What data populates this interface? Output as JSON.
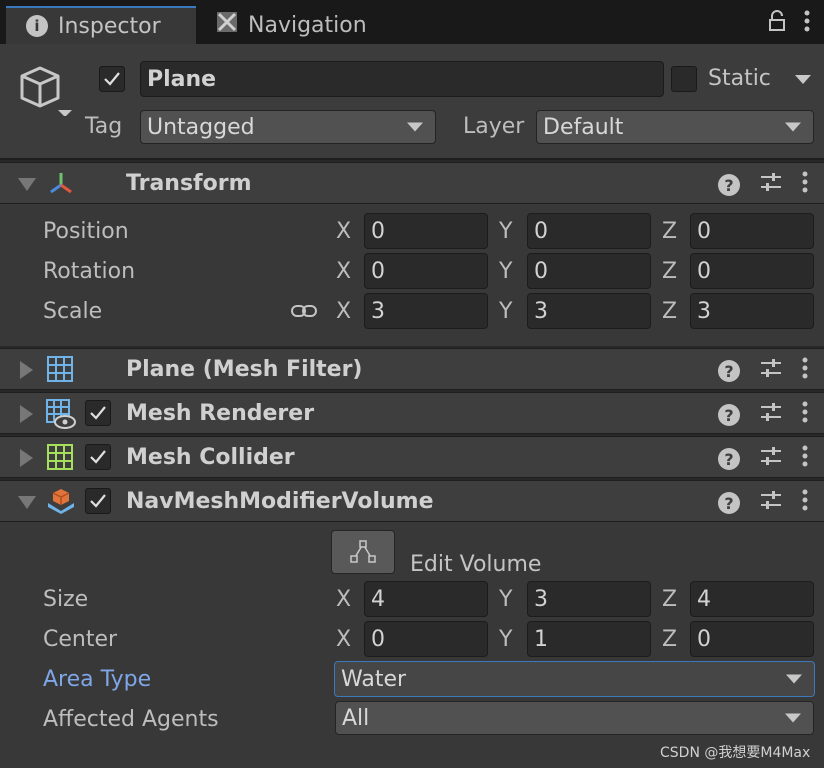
{
  "tabs": {
    "inspector": "Inspector",
    "navigation": "Navigation"
  },
  "header": {
    "object_name": "Plane",
    "static_label": "Static",
    "tag_label": "Tag",
    "tag_value": "Untagged",
    "layer_label": "Layer",
    "layer_value": "Default"
  },
  "transform": {
    "title": "Transform",
    "position_label": "Position",
    "rotation_label": "Rotation",
    "scale_label": "Scale",
    "x": "X",
    "y": "Y",
    "z": "Z",
    "position": [
      "0",
      "0",
      "0"
    ],
    "rotation": [
      "0",
      "0",
      "0"
    ],
    "scale": [
      "3",
      "3",
      "3"
    ]
  },
  "components": {
    "mesh_filter": "Plane (Mesh Filter)",
    "mesh_renderer": "Mesh Renderer",
    "mesh_collider": "Mesh Collider",
    "navmesh_modifier": "NavMeshModifierVolume"
  },
  "navmesh": {
    "edit_volume": "Edit Volume",
    "size_label": "Size",
    "center_label": "Center",
    "area_type_label": "Area Type",
    "affected_agents_label": "Affected Agents",
    "size": [
      "4",
      "3",
      "4"
    ],
    "center": [
      "0",
      "1",
      "0"
    ],
    "area_type": "Water",
    "affected_agents": "All"
  },
  "watermark": "CSDN @我想要M4Max",
  "colors": {
    "accent": "#3a79bb",
    "highlight_label": "#7fa6e6"
  }
}
